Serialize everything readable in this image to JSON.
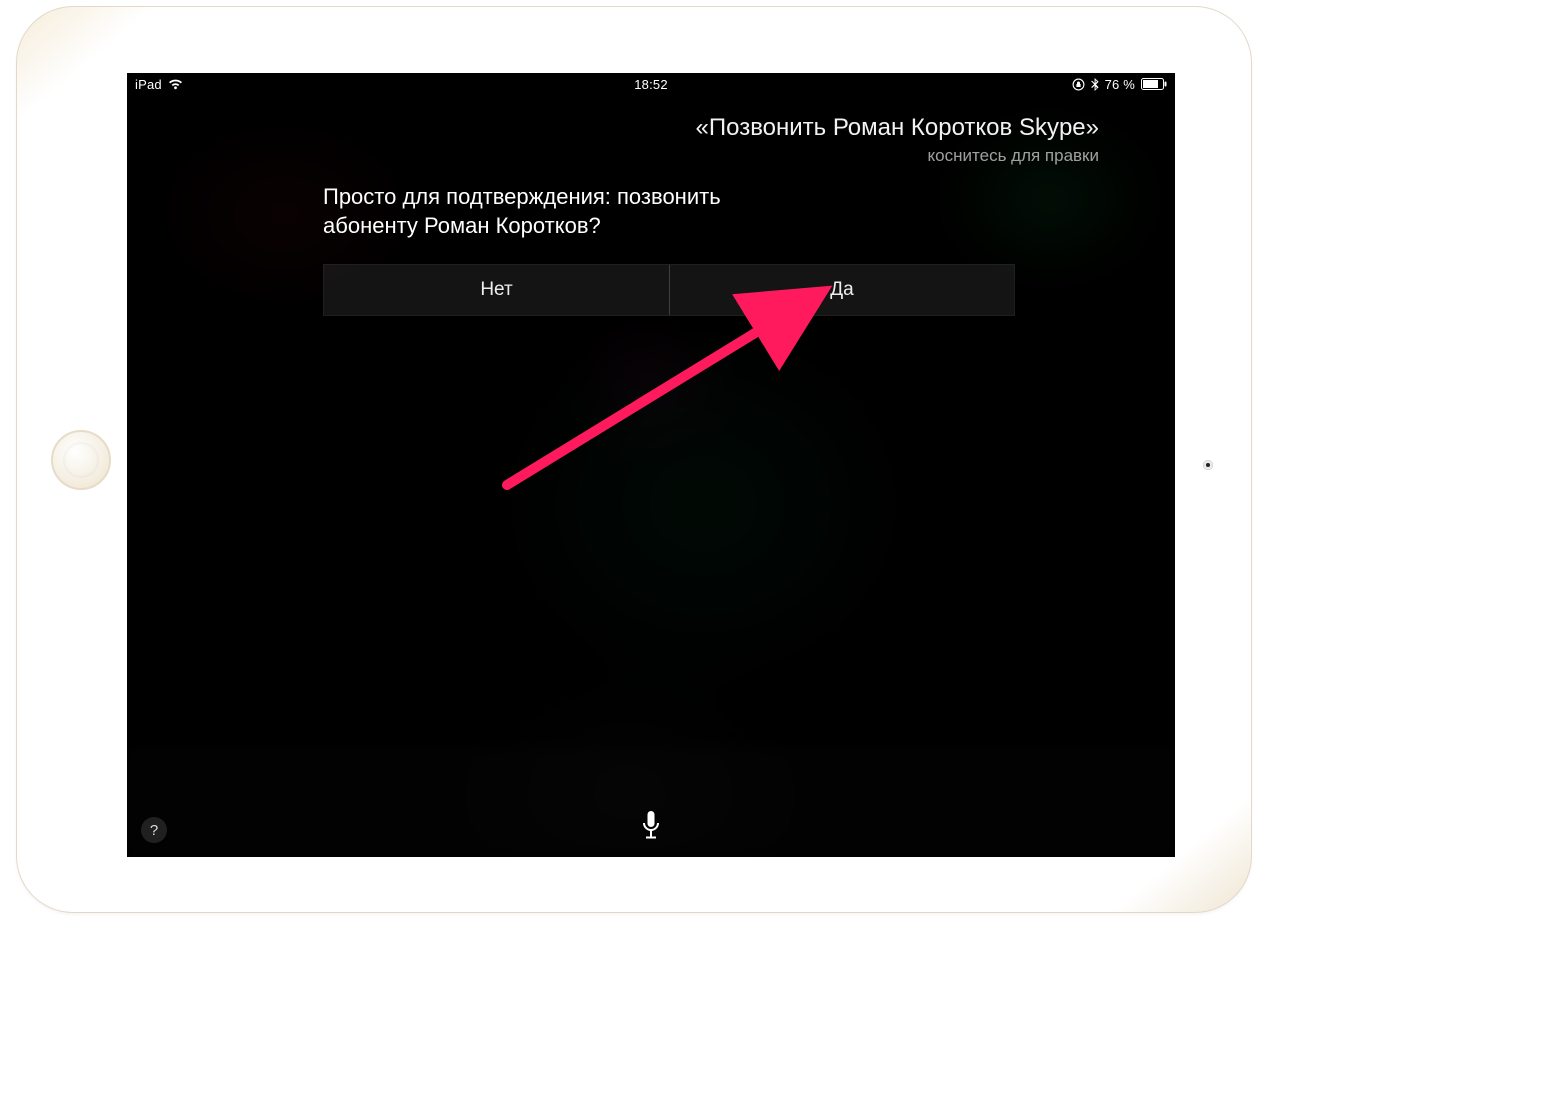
{
  "statusbar": {
    "device": "iPad",
    "time": "18:52",
    "battery_text": "76 %"
  },
  "siri": {
    "echo_phrase": "«Позвонить Роман Коротков Skype»",
    "echo_hint": "коснитесь для правки",
    "confirm_text": "Просто для подтверждения: позвонить абоненту Роман Коротков?",
    "no_label": "Нет",
    "yes_label": "Да",
    "help_label": "?"
  },
  "annotation": {
    "arrow_color": "#ff1a5e"
  }
}
